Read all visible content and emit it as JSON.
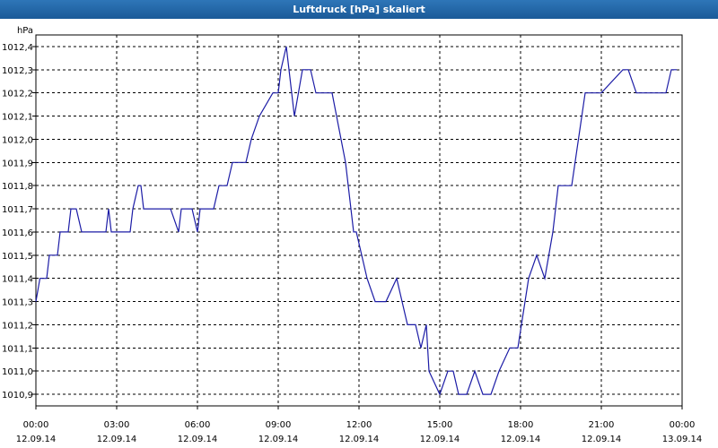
{
  "window": {
    "title": "Luftdruck [hPa] skaliert"
  },
  "chart_data": {
    "type": "line",
    "title": "Luftdruck [hPa] skaliert",
    "ylabel": "hPa",
    "xlabel": "",
    "ylim": [
      1010.85,
      1012.45
    ],
    "y_ticks": [
      1010.9,
      1011.0,
      1011.1,
      1011.2,
      1011.3,
      1011.4,
      1011.5,
      1011.6,
      1011.7,
      1011.8,
      1011.9,
      1012.0,
      1012.1,
      1012.2,
      1012.3,
      1012.4
    ],
    "y_tick_labels": [
      "1010,9",
      "1011,0",
      "1011,1",
      "1011,2",
      "1011,3",
      "1011,4",
      "1011,5",
      "1011,6",
      "1011,7",
      "1011,8",
      "1011,9",
      "1012,0",
      "1012,1",
      "1012,2",
      "1012,3",
      "1012,4"
    ],
    "xlim_hours": [
      0,
      24
    ],
    "x_ticks": [
      {
        "hour": 0,
        "time": "00:00",
        "date": "12.09.14"
      },
      {
        "hour": 3,
        "time": "03:00",
        "date": "12.09.14"
      },
      {
        "hour": 6,
        "time": "06:00",
        "date": "12.09.14"
      },
      {
        "hour": 9,
        "time": "09:00",
        "date": "12.09.14"
      },
      {
        "hour": 12,
        "time": "12:00",
        "date": "12.09.14"
      },
      {
        "hour": 15,
        "time": "15:00",
        "date": "12.09.14"
      },
      {
        "hour": 18,
        "time": "18:00",
        "date": "12.09.14"
      },
      {
        "hour": 21,
        "time": "21:00",
        "date": "12.09.14"
      },
      {
        "hour": 24,
        "time": "00:00",
        "date": "13.09.14"
      }
    ],
    "grid": true,
    "series": [
      {
        "color": "#1c1ca6",
        "x": [
          0,
          0.15,
          0.4,
          0.5,
          0.8,
          0.9,
          1.2,
          1.3,
          1.5,
          1.7,
          1.8,
          2.0,
          2.6,
          2.7,
          2.8,
          3.1,
          3.5,
          3.6,
          3.8,
          3.9,
          4.0,
          4.5,
          4.6,
          4.7,
          4.8,
          5.0,
          5.3,
          5.4,
          5.8,
          6.0,
          6.1,
          6.6,
          6.8,
          7.1,
          7.3,
          7.8,
          8.0,
          8.3,
          8.8,
          9.0,
          9.1,
          9.3,
          9.6,
          9.9,
          10.2,
          10.4,
          10.6,
          11.0,
          11.5,
          11.8,
          11.9,
          12.3,
          12.6,
          13.0,
          13.4,
          13.6,
          13.8,
          14.1,
          14.3,
          14.5,
          14.6,
          15.0,
          15.3,
          15.5,
          15.7,
          16.0,
          16.3,
          16.6,
          16.9,
          17.2,
          17.6,
          17.9,
          18.3,
          18.6,
          18.9,
          19.2,
          19.4,
          19.6,
          19.9,
          20.4,
          20.6,
          21.0,
          21.8,
          22.0,
          22.3,
          22.6,
          23.0,
          23.4,
          23.6,
          23.8
        ],
        "y": [
          1011.3,
          1011.4,
          1011.4,
          1011.5,
          1011.5,
          1011.6,
          1011.6,
          1011.7,
          1011.7,
          1011.6,
          1011.6,
          1011.6,
          1011.6,
          1011.7,
          1011.6,
          1011.6,
          1011.6,
          1011.7,
          1011.8,
          1011.8,
          1011.7,
          1011.7,
          1011.7,
          1011.7,
          1011.7,
          1011.7,
          1011.6,
          1011.7,
          1011.7,
          1011.6,
          1011.7,
          1011.7,
          1011.8,
          1011.8,
          1011.9,
          1011.9,
          1012.0,
          1012.1,
          1012.2,
          1012.2,
          1012.3,
          1012.4,
          1012.1,
          1012.3,
          1012.3,
          1012.2,
          1012.2,
          1012.2,
          1011.9,
          1011.6,
          1011.6,
          1011.4,
          1011.3,
          1011.3,
          1011.4,
          1011.3,
          1011.2,
          1011.2,
          1011.1,
          1011.2,
          1011.0,
          1010.9,
          1011.0,
          1011.0,
          1010.9,
          1010.9,
          1011.0,
          1010.9,
          1010.9,
          1011.0,
          1011.1,
          1011.1,
          1011.4,
          1011.5,
          1011.4,
          1011.6,
          1011.8,
          1011.8,
          1011.8,
          1012.2,
          1012.2,
          1012.2,
          1012.3,
          1012.3,
          1012.2,
          1012.2,
          1012.2,
          1012.2,
          1012.3,
          1012.3
        ]
      }
    ]
  }
}
